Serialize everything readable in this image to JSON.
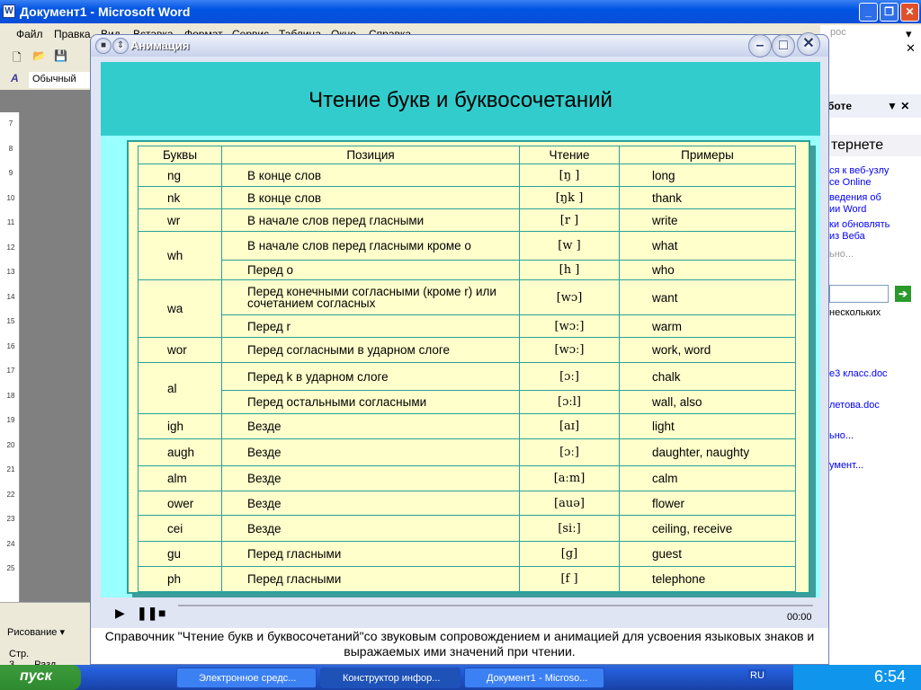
{
  "word": {
    "title": "Документ1 - Microsoft Word",
    "menu": [
      "Файл",
      "Правка",
      "Вид",
      "Вставка",
      "Формат",
      "Сервис",
      "Таблица",
      "Окно",
      "Справка"
    ],
    "style": "Обычный",
    "ask_placeholder": "рос",
    "drawing": "Рисование",
    "status": [
      "Стр. 3",
      "Разд"
    ],
    "ruler": [
      "7",
      "8",
      "9",
      "10",
      "11",
      "12",
      "13",
      "14",
      "15",
      "16",
      "17",
      "18",
      "19",
      "20",
      "21",
      "22",
      "23",
      "24",
      "25"
    ]
  },
  "taskpane": {
    "title": "боте",
    "band": "тернете",
    "links": [
      "ся к веб-узлу",
      "се Online",
      "ведения об",
      "ии Word",
      "ки обновлять",
      "из Веба"
    ],
    "more1": "ьно...",
    "search_hint": "нескольких",
    "files": [
      "е3 класс.doc",
      "летова.doc"
    ],
    "more2": "ьно...",
    "doc": "умент..."
  },
  "dialog": {
    "title": "Анимация",
    "heading": "Чтение букв и буквосочетаний",
    "time": "00:00",
    "caption": "Справочник \"Чтение букв и буквосочетаний\"со звуковым сопровождением и анимацией для усвоения языковых знаков и выражаемых ими значений при чтении."
  },
  "table": {
    "headers": [
      "Буквы",
      "Позиция",
      "Чтение",
      "Примеры"
    ],
    "rows": [
      {
        "letters": "ng",
        "span": 1,
        "position": "В конце слов",
        "reading": "[ŋ ]",
        "examples": "long"
      },
      {
        "letters": "nk",
        "span": 1,
        "position": "В конце слов",
        "reading": "[ŋk ]",
        "examples": "thank"
      },
      {
        "letters": "wr",
        "span": 1,
        "position": "В начале слов перед гласными",
        "reading": "[r ]",
        "examples": "write"
      },
      {
        "letters": "wh",
        "span": 2,
        "position": "В начале слов перед гласными кроме о",
        "reading": "[w ]",
        "examples": "what"
      },
      {
        "position": "Перед о",
        "reading": "[h ]",
        "examples": "who"
      },
      {
        "letters": "wa",
        "span": 2,
        "position": "Перед конечными согласными (кроме r) или сочетанием согласных",
        "reading": "[wɔ]",
        "examples": "want"
      },
      {
        "position": "Перед r",
        "reading": "[wɔː]",
        "examples": "warm"
      },
      {
        "letters": "wor",
        "span": 1,
        "position": "Перед согласными в ударном слоге",
        "reading": "[wɔː]",
        "examples": "work, word"
      },
      {
        "letters": "al",
        "span": 2,
        "position": "Перед k  в ударном слоге",
        "reading": "[ɔː]",
        "examples": "chalk"
      },
      {
        "position": "Перед остальными согласными",
        "reading": "[ɔːl]",
        "examples": "wall, also"
      },
      {
        "letters": "igh",
        "span": 1,
        "position": "Везде",
        "reading": "[aɪ]",
        "examples": "light"
      },
      {
        "letters": "augh",
        "span": 1,
        "position": "Везде",
        "reading": "[ɔː]",
        "examples": "daughter, naughty"
      },
      {
        "letters": "alm",
        "span": 1,
        "position": "Везде",
        "reading": "[aːm]",
        "examples": "calm"
      },
      {
        "letters": "ower",
        "span": 1,
        "position": "Везде",
        "reading": "[auə]",
        "examples": "flower"
      },
      {
        "letters": "cei",
        "span": 1,
        "position": "Везде",
        "reading": "[siː]",
        "examples": "ceiling, receive"
      },
      {
        "letters": "gu",
        "span": 1,
        "position": "Перед гласными",
        "reading": "[g]",
        "examples": "guest"
      },
      {
        "letters": "ph",
        "span": 1,
        "position": "Перед гласными",
        "reading": "[f ]",
        "examples": "telephone"
      }
    ]
  },
  "taskbar": {
    "start": "пуск",
    "tasks": [
      "Электронное средс...",
      "Конструктор инфор...",
      "Документ1 - Microso..."
    ],
    "lang": "RU",
    "clock": "6:54"
  },
  "colors": {
    "band": "#33cccc",
    "stage": "#99ffff",
    "table_bg": "#ffffcc",
    "grid": "#2aa199"
  }
}
